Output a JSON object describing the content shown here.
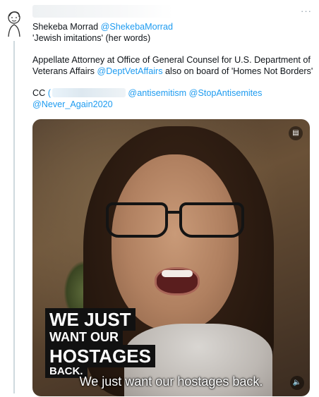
{
  "tweet": {
    "author_name": "Shekeba Morrad",
    "author_handle": "@ShekebaMorrad",
    "more_glyph": "···",
    "line1": "'Jewish imitations' (her words)",
    "line2_pre": "Appellate Attorney at Office of General Counsel for U.S. Department of Veterans Affairs ",
    "line2_mention": "@DeptVetAffairs",
    "line2_post": " also on board of 'Homes Not Borders'",
    "cc_label": "CC",
    "cc_paren": "(",
    "cc_mention1": "@antisemitism",
    "cc_mention2": "@StopAntisemites",
    "cc_mention3": "@Never_Again2020"
  },
  "video": {
    "overlay_line1": "WE JUST",
    "overlay_line2": "WANT OUR",
    "overlay_line3": "HOSTAGES",
    "overlay_line4": "BACK.",
    "caption": "We just want our hostages back.",
    "settings_icon": "captions-icon",
    "volume_icon": "volume-icon"
  },
  "colors": {
    "link": "#1d9bf0",
    "text": "#0f1419",
    "thread_line": "#cfd9de"
  }
}
